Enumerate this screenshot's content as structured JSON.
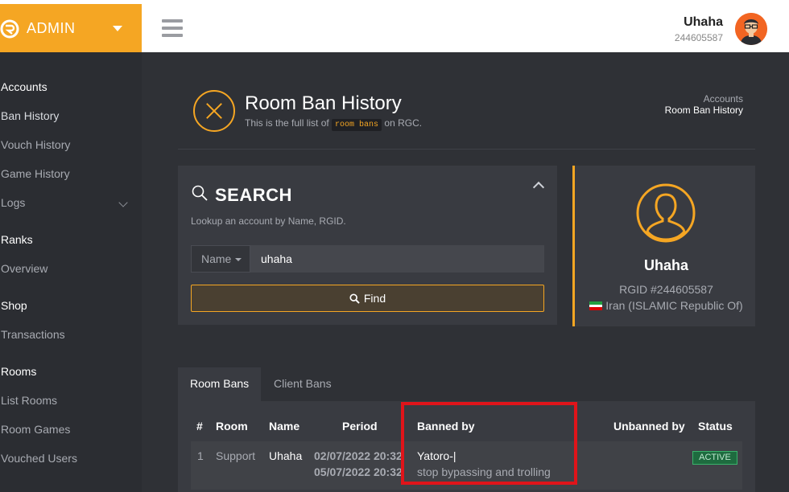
{
  "brand": {
    "label": "ADMIN"
  },
  "sidebar": {
    "sections": [
      {
        "label": "Accounts",
        "items": [
          "Ban History",
          "Vouch History",
          "Game History",
          "Logs"
        ]
      },
      {
        "label": "Ranks",
        "items": [
          "Overview"
        ]
      },
      {
        "label": "Shop",
        "items": [
          "Transactions"
        ]
      },
      {
        "label": "Rooms",
        "items": [
          "List Rooms",
          "Room Games",
          "Vouched Users"
        ]
      }
    ]
  },
  "header": {
    "user_name": "Uhaha",
    "user_id": "244605587"
  },
  "page": {
    "title": "Room Ban History",
    "subtitle_pre": "This is the full list of",
    "subtitle_code": "room bans",
    "subtitle_post": "on RGC.",
    "breadcrumb": [
      "Accounts",
      "Room Ban History"
    ]
  },
  "search": {
    "title": "SEARCH",
    "description": "Lookup an account by Name, RGID.",
    "select_value": "Name",
    "input_value": "uhaha",
    "button_label": "Find"
  },
  "profile": {
    "name": "Uhaha",
    "rgid": "RGID #244605587",
    "country": "Iran (ISLAMIC Republic Of)"
  },
  "tabs": [
    {
      "label": "Room Bans",
      "active": true
    },
    {
      "label": "Client Bans",
      "active": false
    }
  ],
  "table": {
    "headers": [
      "#",
      "Room",
      "Name",
      "Period",
      "Banned by",
      "Unbanned by",
      "Status"
    ],
    "rows": [
      {
        "index": "1",
        "room": "Support",
        "name": "Uhaha",
        "period_start": "02/07/2022 20:32",
        "period_end": "05/07/2022 20:32",
        "banned_by": "Yatoro-|",
        "reason": "stop bypassing and trolling",
        "unbanned_by": "",
        "status": "ACTIVE"
      }
    ]
  },
  "colors": {
    "accent": "#f5a623",
    "highlight": "#e0141a",
    "status_active": "#1e6b3f"
  }
}
